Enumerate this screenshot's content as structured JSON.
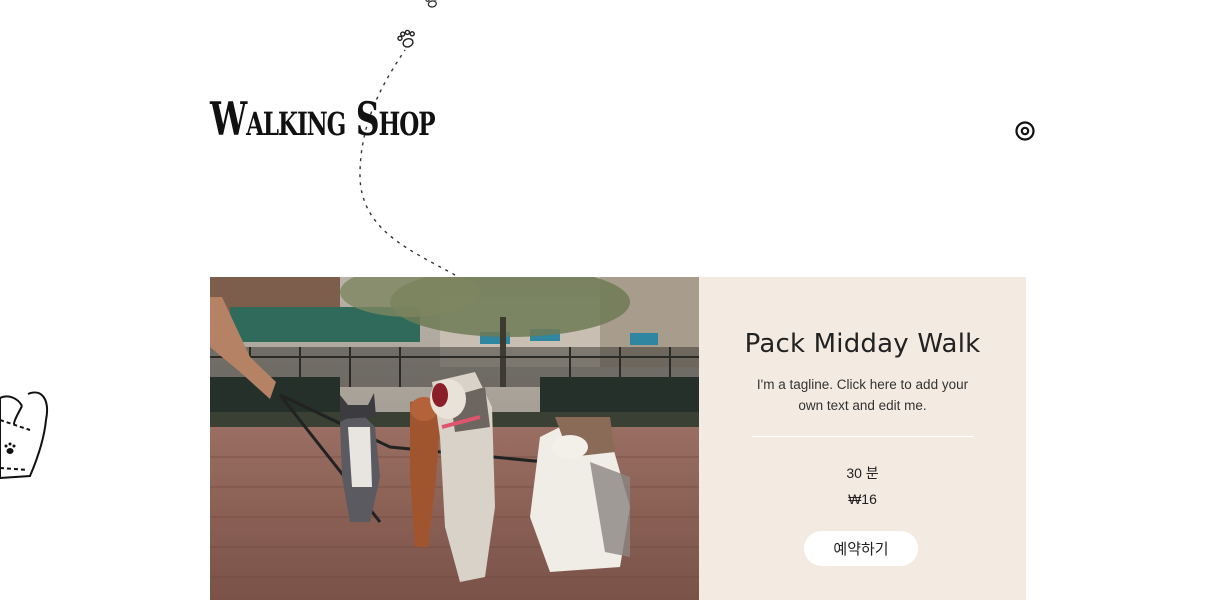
{
  "header": {
    "logo_text": "Walking Shop",
    "cart_icon": "cart-icon"
  },
  "service": {
    "title": "Pack Midday Walk",
    "tagline": "I'm a tagline. Click here to add your own text and edit me.",
    "duration": "30 분",
    "price": "₩16",
    "book_label": "예약하기"
  },
  "colors": {
    "panel_bg": "#f3ebe1",
    "button_bg": "#ffffff",
    "text": "#222222"
  },
  "icons": [
    "paw-print-icon",
    "poop-bag-icon",
    "cart-icon"
  ]
}
